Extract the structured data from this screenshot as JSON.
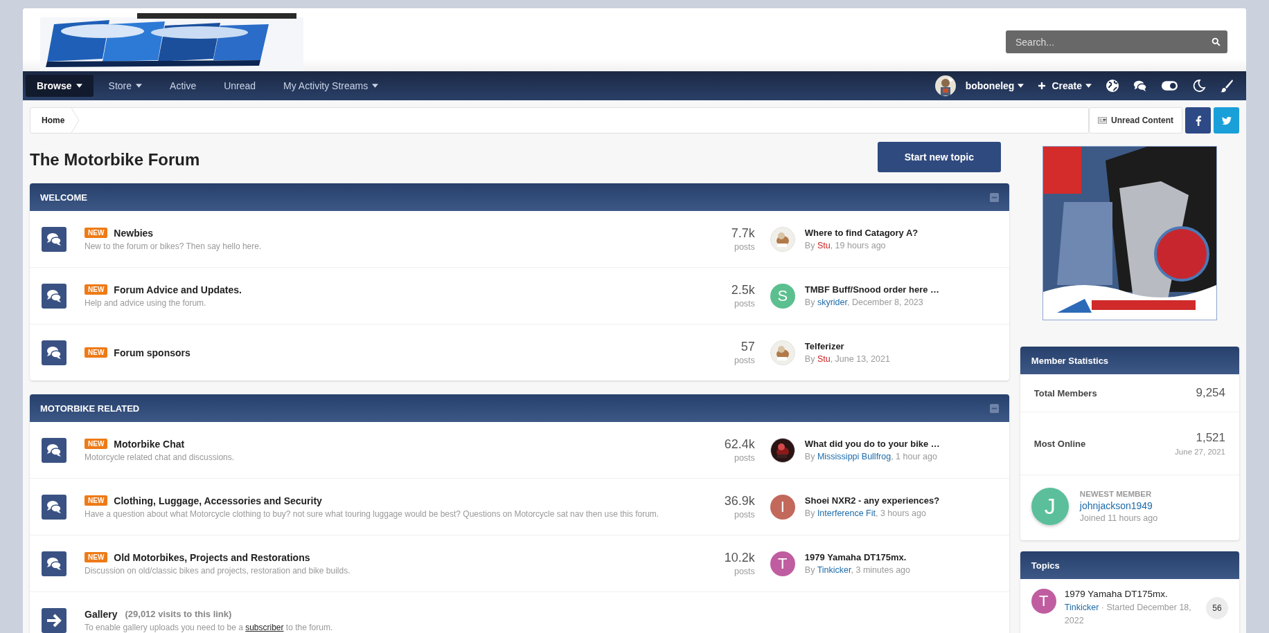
{
  "header": {
    "search": {
      "placeholder": "Search..."
    }
  },
  "nav": {
    "items": [
      {
        "label": "Browse",
        "selected": true,
        "dropdown": true
      },
      {
        "label": "Store",
        "selected": false,
        "dropdown": true
      },
      {
        "label": "Active",
        "selected": false,
        "dropdown": false
      },
      {
        "label": "Unread",
        "selected": false,
        "dropdown": false
      },
      {
        "label": "My Activity Streams",
        "selected": false,
        "dropdown": true
      }
    ],
    "user": {
      "name": "boboneleg"
    },
    "create": "Create"
  },
  "breadcrumb": {
    "items": [
      "Home"
    ],
    "unread": "Unread Content"
  },
  "page": {
    "title": "The Motorbike Forum",
    "button": "Start new topic"
  },
  "categories": [
    {
      "title": "WELCOME",
      "forums": [
        {
          "kind": "forum",
          "new": true,
          "badge": "NEW",
          "name": "Newbies",
          "description": "New to the forum or bikes? Then say hello here.",
          "count": "7.7k",
          "count_label": "posts",
          "last": {
            "title": "Where to find Catagory A?",
            "by": "By",
            "author": "Stu",
            "color": "#cc1b1b",
            "time": ", 19 hours ago"
          }
        },
        {
          "kind": "forum",
          "new": true,
          "badge": "NEW",
          "name": "Forum Advice and Updates.",
          "description": "Help and advice using the forum.",
          "count": "2.5k",
          "count_label": "posts",
          "last": {
            "title": "TMBF Buff/Snood order here …",
            "by": "By",
            "author": "skyrider",
            "color": "#1c6aa8",
            "time": ", December 8, 2023",
            "avatar": {
              "kind": "letter",
              "letter": "S",
              "color": "#5bbf8f"
            }
          }
        },
        {
          "kind": "forum",
          "new": true,
          "badge": "NEW",
          "name": "Forum sponsors",
          "count": "57",
          "count_label": "posts",
          "last": {
            "title": "Telferizer",
            "by": "By",
            "author": "Stu",
            "color": "#cc1b1b",
            "time": ", June 13, 2021"
          }
        }
      ]
    },
    {
      "title": "MOTORBIKE RELATED",
      "forums": [
        {
          "kind": "forum",
          "new": true,
          "badge": "NEW",
          "name": "Motorbike Chat",
          "description": "Motorcycle related chat and discussions.",
          "count": "62.4k",
          "count_label": "posts",
          "last": {
            "title": "What did you do to your bike …",
            "by": "By",
            "author": "Mississippi Bullfrog",
            "color": "#1c6aa8",
            "time": ", 1 hour ago"
          }
        },
        {
          "kind": "forum",
          "new": true,
          "badge": "NEW",
          "name": "Clothing, Luggage, Accessories and Security",
          "description": "Have a question about what Motorcycle clothing to buy? not sure what touring luggage would be best? Questions on Motorcycle sat nav then use this forum.",
          "count": "36.9k",
          "count_label": "posts",
          "last": {
            "title": "Shoei NXR2 - any experiences?",
            "by": "By",
            "author": "Interference Fit",
            "color": "#1c6aa8",
            "time": ", 3 hours ago",
            "avatar": {
              "kind": "letter",
              "letter": "I",
              "color": "#c2695c"
            }
          }
        },
        {
          "kind": "forum",
          "new": true,
          "badge": "NEW",
          "name": "Old Motorbikes, Projects and Restorations",
          "description": "Discussion on old/classic bikes and projects, restoration and bike builds.",
          "count": "10.2k",
          "count_label": "posts",
          "last": {
            "title": "1979 Yamaha DT175mx.",
            "by": "By",
            "author": "Tinkicker",
            "color": "#1c6aa8",
            "time": ", 3 minutes ago",
            "avatar": {
              "kind": "letter",
              "letter": "T",
              "color": "#c05da0"
            }
          }
        },
        {
          "kind": "link",
          "name": "Gallery",
          "visits": "(29,012 visits to this link)",
          "description": [
            "To enable gallery uploads you need to be a ",
            "subscriber",
            " to the forum."
          ]
        }
      ]
    }
  ],
  "sidebar": {
    "stats": {
      "title": "Member Statistics",
      "rows": [
        {
          "label": "Total Members",
          "value": "9,254"
        },
        {
          "label": "Most Online",
          "value": "1,521",
          "date": "June 27, 2021"
        }
      ],
      "newest": {
        "label": "NEWEST MEMBER",
        "name": "johnjackson1949",
        "joined": "Joined 11 hours ago",
        "avatar": {
          "kind": "letter",
          "letter": "J",
          "color": "#5bbf9c"
        }
      }
    },
    "topics": {
      "title": "Topics",
      "items": [
        {
          "title": "1979 Yamaha DT175mx.",
          "author": "Tinkicker",
          "meta": "· Started December 18, 2022",
          "count": "56",
          "avatar": {
            "kind": "letter",
            "letter": "T",
            "color": "#c05da0"
          }
        }
      ]
    }
  }
}
